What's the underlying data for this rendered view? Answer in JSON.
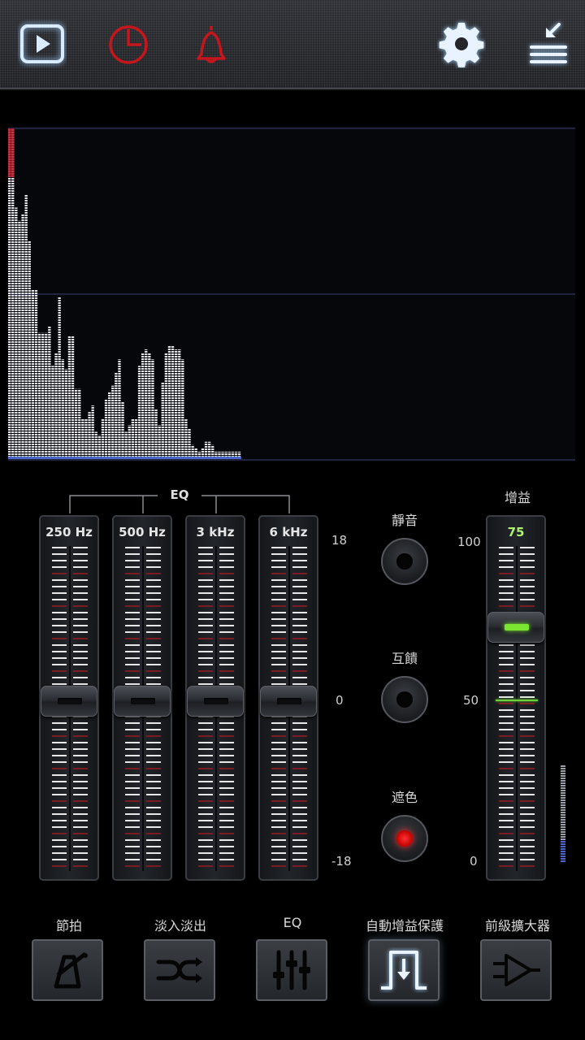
{
  "toolbar": {
    "icons": [
      "play-icon",
      "timer-icon",
      "alarm-bell-icon",
      "settings-gear-icon",
      "menu-collapse-icon"
    ],
    "accent_active": "#d9ecff",
    "accent_inactive_red": "#c4161c"
  },
  "eq": {
    "title": "EQ",
    "bands": [
      {
        "label": "250 Hz",
        "level_db": 0
      },
      {
        "label": "500 Hz",
        "level_db": 0
      },
      {
        "label": "3 kHz",
        "level_db": 0
      },
      {
        "label": "6 kHz",
        "level_db": 0
      }
    ],
    "scale": {
      "top": "18",
      "mid": "0",
      "bottom": "-18"
    }
  },
  "controls": {
    "mute_label": "靜音",
    "feedback_label": "互饋",
    "mask_label": "遮色",
    "mask_active_color": "#ff2020"
  },
  "gain": {
    "title": "增益",
    "value": "75",
    "level_percent": 75,
    "scale": {
      "top": "100",
      "mid": "50",
      "bottom": "0"
    },
    "value_color": "#aef36a"
  },
  "bottom": {
    "buttons": [
      {
        "label": "節拍",
        "icon": "metronome-icon"
      },
      {
        "label": "淡入淡出",
        "icon": "shuffle-crossfade-icon"
      },
      {
        "label": "EQ",
        "icon": "equalizer-sliders-icon"
      },
      {
        "label": "自動增益保護",
        "icon": "auto-gain-protect-icon"
      },
      {
        "label": "前級擴大器",
        "icon": "preamp-amplifier-icon"
      }
    ]
  },
  "spectrum": {
    "bar_levels": [
      1.0,
      1.0,
      0.76,
      0.72,
      0.74,
      0.8,
      0.66,
      0.51,
      0.51,
      0.38,
      0.38,
      0.38,
      0.4,
      0.28,
      0.32,
      0.49,
      0.3,
      0.27,
      0.37,
      0.37,
      0.21,
      0.21,
      0.12,
      0.12,
      0.14,
      0.16,
      0.08,
      0.07,
      0.12,
      0.18,
      0.2,
      0.22,
      0.26,
      0.3,
      0.17,
      0.08,
      0.1,
      0.12,
      0.12,
      0.28,
      0.32,
      0.33,
      0.32,
      0.3,
      0.15,
      0.1,
      0.23,
      0.32,
      0.34,
      0.34,
      0.33,
      0.33,
      0.3,
      0.12,
      0.09,
      0.04,
      0.03,
      0.02,
      0.03,
      0.05,
      0.05,
      0.04,
      0.02,
      0.02,
      0.02,
      0.02,
      0.02,
      0.02,
      0.02,
      0.02
    ]
  }
}
